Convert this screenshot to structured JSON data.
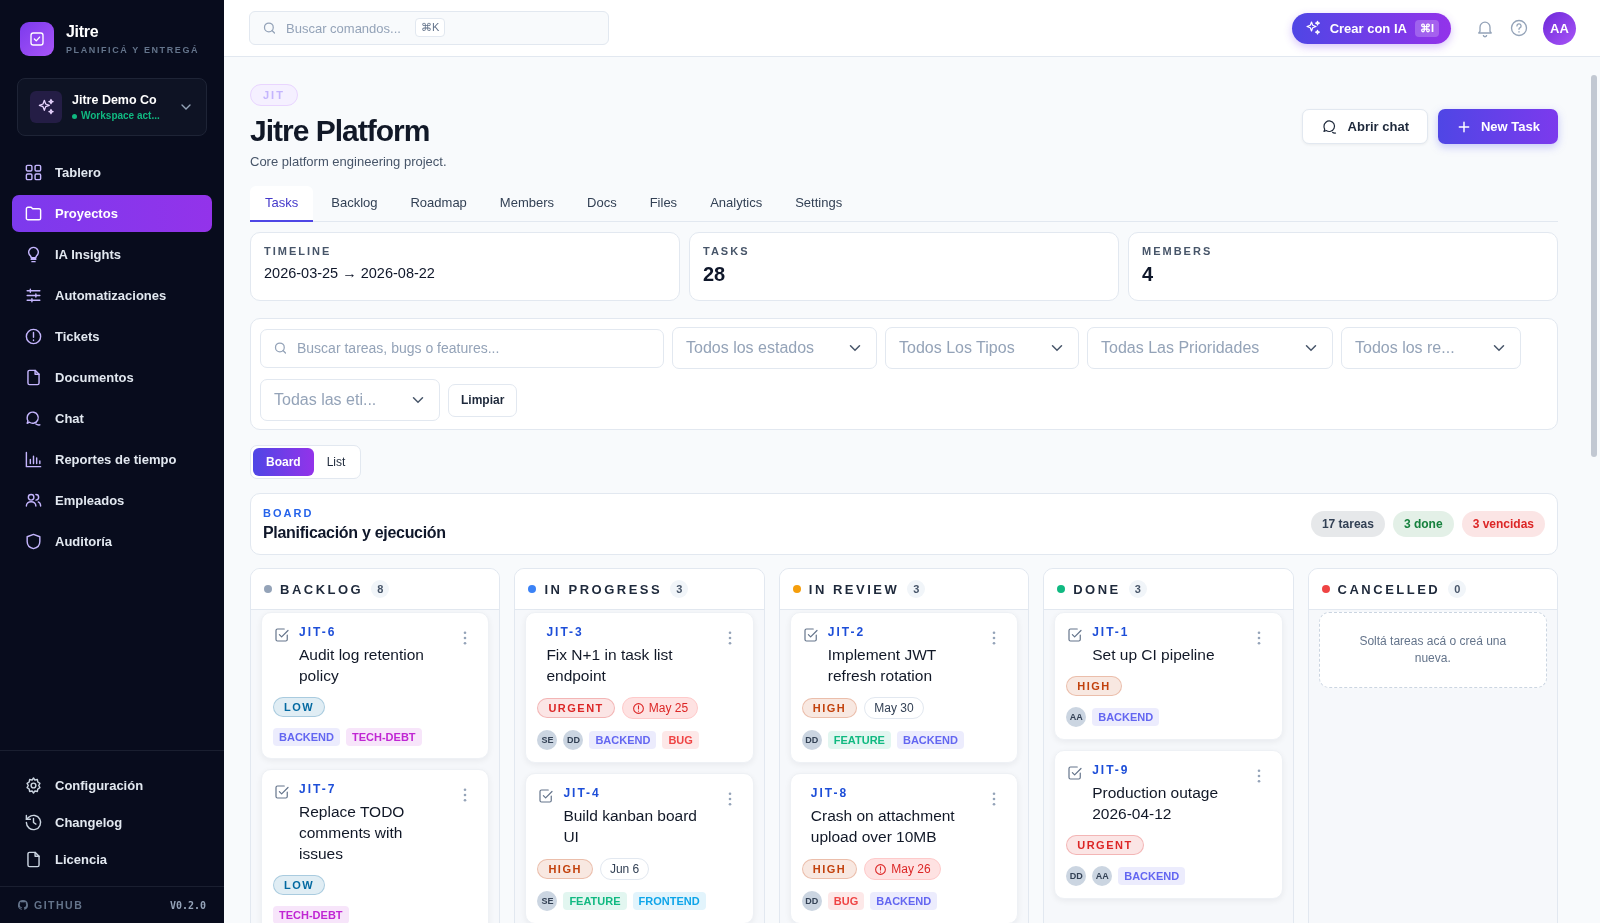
{
  "sidebar": {
    "brand": {
      "name": "Jitre",
      "tagline": "PLANIFICÁ Y ENTREGÁ"
    },
    "workspace": {
      "name": "Jitre Demo Co",
      "status": "Workspace act..."
    },
    "items": [
      {
        "label": "Tablero",
        "selected": false
      },
      {
        "label": "Proyectos",
        "selected": true
      },
      {
        "label": "IA Insights",
        "selected": false
      },
      {
        "label": "Automatizaciones",
        "selected": false
      },
      {
        "label": "Tickets",
        "selected": false
      },
      {
        "label": "Documentos",
        "selected": false
      },
      {
        "label": "Chat",
        "selected": false
      },
      {
        "label": "Reportes de tiempo",
        "selected": false
      },
      {
        "label": "Empleados",
        "selected": false
      },
      {
        "label": "Auditoría",
        "selected": false
      }
    ],
    "footer_items": [
      {
        "label": "Configuración"
      },
      {
        "label": "Changelog"
      },
      {
        "label": "Licencia"
      }
    ],
    "github": "GITHUB",
    "version": "V0.2.0"
  },
  "topbar": {
    "search": {
      "placeholder": "Buscar comandos..."
    },
    "shortcut": "⌘K",
    "ai_button": {
      "label": "Crear con IA",
      "shortcut": "⌘I"
    },
    "avatar": "AA"
  },
  "project": {
    "key": "JIT",
    "title": "Jitre Platform",
    "description": "Core platform engineering project.",
    "actions": [
      {
        "label": "Abrir chat",
        "kind": "secondary"
      },
      {
        "label": "New Task",
        "kind": "primary"
      }
    ]
  },
  "tabs": [
    {
      "label": "Tasks",
      "selected": true
    },
    {
      "label": "Backlog",
      "selected": false
    },
    {
      "label": "Roadmap",
      "selected": false
    },
    {
      "label": "Members",
      "selected": false
    },
    {
      "label": "Docs",
      "selected": false
    },
    {
      "label": "Files",
      "selected": false
    },
    {
      "label": "Analytics",
      "selected": false
    },
    {
      "label": "Settings",
      "selected": false
    }
  ],
  "stats": [
    {
      "label": "TIMELINE",
      "value": "2026-03-25 → 2026-08-22",
      "kind": "text"
    },
    {
      "label": "TASKS",
      "value": "28",
      "kind": "number"
    },
    {
      "label": "MEMBERS",
      "value": "4",
      "kind": "number"
    }
  ],
  "filters": {
    "search": {
      "placeholder": "Buscar tareas, bugs o features..."
    },
    "selects": [
      {
        "placeholder": "Todos los estados"
      },
      {
        "placeholder": "Todos Los Tipos"
      },
      {
        "placeholder": "Todas Las Prioridades"
      },
      {
        "placeholder": "Todos los re..."
      },
      {
        "placeholder": "Todas las eti..."
      }
    ],
    "clear": "Limpiar"
  },
  "view_toggle": [
    {
      "label": "Board",
      "selected": true
    },
    {
      "label": "List",
      "selected": false
    }
  ],
  "board": {
    "eyebrow": "BOARD",
    "title": "Planificación y ejecución",
    "badges": [
      {
        "label": "17 tareas",
        "color": "#334155"
      },
      {
        "label": "3 done",
        "color": "#15803d"
      },
      {
        "label": "3 vencidas",
        "color": "#dc2626"
      }
    ],
    "columns": [
      {
        "name": "BACKLOG",
        "count": "8",
        "color": "#94a3b8",
        "cards": [
          {
            "id": "JIT-6",
            "kind": "task",
            "title": "Audit log retention policy",
            "priority": {
              "label": "LOW",
              "color": "#0369a1"
            },
            "tags": [
              {
                "label": "BACKEND",
                "color": "#6366f1"
              },
              {
                "label": "TECH-DEBT",
                "color": "#c026d3"
              }
            ]
          },
          {
            "id": "JIT-7",
            "kind": "task",
            "title": "Replace TODO comments with issues",
            "priority": {
              "label": "LOW",
              "color": "#0369a1"
            },
            "tags": [
              {
                "label": "TECH-DEBT",
                "color": "#c026d3"
              }
            ]
          }
        ]
      },
      {
        "name": "IN PROGRESS",
        "count": "3",
        "color": "#3b82f6",
        "cards": [
          {
            "id": "JIT-3",
            "kind": "bug",
            "title": "Fix N+1 in task list endpoint",
            "priority": {
              "label": "URGENT",
              "color": "#dc2626"
            },
            "due": {
              "label": "May 25",
              "overdue": true
            },
            "assignees": [
              "SE",
              "DD"
            ],
            "tags": [
              {
                "label": "BACKEND",
                "color": "#6366f1"
              },
              {
                "label": "BUG",
                "color": "#ef4444"
              }
            ]
          },
          {
            "id": "JIT-4",
            "kind": "task",
            "title": "Build kanban board UI",
            "priority": {
              "label": "HIGH",
              "color": "#c2410c"
            },
            "due": {
              "label": "Jun 6",
              "overdue": false
            },
            "assignees": [
              "SE"
            ],
            "tags": [
              {
                "label": "FEATURE",
                "color": "#10b981"
              },
              {
                "label": "FRONTEND",
                "color": "#0ea5e9"
              }
            ]
          }
        ]
      },
      {
        "name": "IN REVIEW",
        "count": "3",
        "color": "#f59e0b",
        "cards": [
          {
            "id": "JIT-2",
            "kind": "task",
            "title": "Implement JWT refresh rotation",
            "priority": {
              "label": "HIGH",
              "color": "#c2410c"
            },
            "due": {
              "label": "May 30",
              "overdue": false
            },
            "assignees": [
              "DD"
            ],
            "tags": [
              {
                "label": "FEATURE",
                "color": "#10b981"
              },
              {
                "label": "BACKEND",
                "color": "#6366f1"
              }
            ]
          },
          {
            "id": "JIT-8",
            "kind": "bug",
            "title": "Crash on attachment upload over 10MB",
            "priority": {
              "label": "HIGH",
              "color": "#c2410c"
            },
            "due": {
              "label": "May 26",
              "overdue": true
            },
            "assignees": [
              "DD"
            ],
            "tags": [
              {
                "label": "BUG",
                "color": "#ef4444"
              },
              {
                "label": "BACKEND",
                "color": "#6366f1"
              }
            ]
          }
        ]
      },
      {
        "name": "DONE",
        "count": "3",
        "color": "#10b981",
        "cards": [
          {
            "id": "JIT-1",
            "kind": "task",
            "title": "Set up CI pipeline",
            "priority": {
              "label": "HIGH",
              "color": "#c2410c"
            },
            "assignees": [
              "AA"
            ],
            "tags": [
              {
                "label": "BACKEND",
                "color": "#6366f1"
              }
            ]
          },
          {
            "id": "JIT-9",
            "kind": "task",
            "title": "Production outage 2026-04-12",
            "priority": {
              "label": "URGENT",
              "color": "#dc2626"
            },
            "assignees": [
              "DD",
              "AA"
            ],
            "tags": [
              {
                "label": "BACKEND",
                "color": "#6366f1"
              }
            ]
          }
        ]
      },
      {
        "name": "CANCELLED",
        "count": "0",
        "color": "#ef4444",
        "empty_text": "Soltá tareas acá o creá una nueva."
      }
    ]
  }
}
